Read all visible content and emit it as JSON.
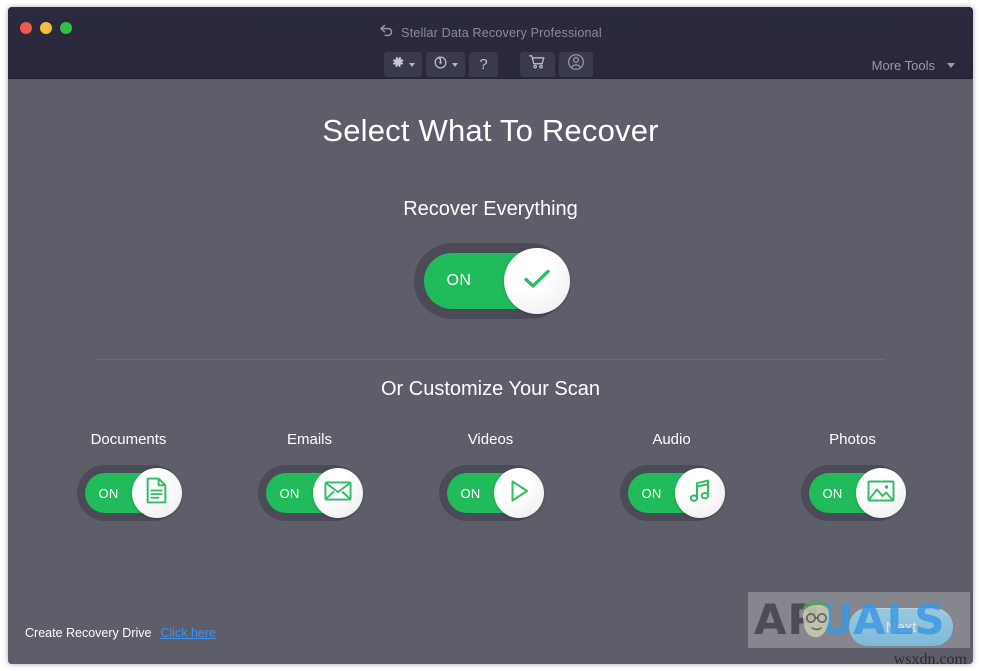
{
  "window": {
    "title": "Stellar Data Recovery Professional",
    "back_icon": "back-arrow-icon",
    "controls": {
      "close": "close-window-button",
      "minimize": "minimize-window-button",
      "maximize": "maximize-window-button"
    }
  },
  "toolbar": {
    "settings": {
      "name": "settings-gear-button",
      "icon": "gear-icon",
      "has_dropdown": true
    },
    "history": {
      "name": "recovery-history-button",
      "icon": "clock-restore-icon",
      "has_dropdown": true
    },
    "help": {
      "name": "help-button",
      "label": "?"
    },
    "cart": {
      "name": "cart-button",
      "icon": "shopping-cart-icon"
    },
    "account": {
      "name": "account-button",
      "icon": "user-circle-icon"
    },
    "more_tools": {
      "label": "More Tools",
      "icon": "chevron-down-icon"
    }
  },
  "main": {
    "heading": "Select What To Recover",
    "subheading": "Recover Everything",
    "master_toggle": {
      "state_label": "ON",
      "icon": "check-icon",
      "enabled": true
    },
    "customize_heading": "Or Customize Your Scan",
    "categories": [
      {
        "label": "Documents",
        "state_label": "ON",
        "icon": "document-icon",
        "enabled": true
      },
      {
        "label": "Emails",
        "state_label": "ON",
        "icon": "envelope-icon",
        "enabled": true
      },
      {
        "label": "Videos",
        "state_label": "ON",
        "icon": "play-icon",
        "enabled": true
      },
      {
        "label": "Audio",
        "state_label": "ON",
        "icon": "music-note-icon",
        "enabled": true
      },
      {
        "label": "Photos",
        "state_label": "ON",
        "icon": "image-icon",
        "enabled": true
      }
    ]
  },
  "footer": {
    "recovery_drive_label": "Create Recovery Drive",
    "recovery_drive_link": "Click here",
    "next_label": "Next"
  },
  "watermark": {
    "brand_part1": "AP",
    "brand_part2": "UALS",
    "site": "wsxdn.com"
  },
  "colors": {
    "titlebar": "#2b2b3e",
    "background": "#5e5e6b",
    "toggle_green": "#22bb5b",
    "toggle_housing": "#4b4b58",
    "link_blue": "#3d92f0",
    "next_blue": "#51b6ef"
  }
}
